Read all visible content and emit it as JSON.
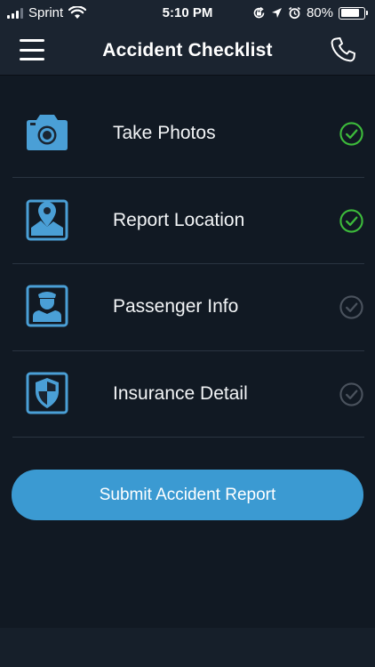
{
  "status_bar": {
    "carrier": "Sprint",
    "time": "5:10 PM",
    "battery_percent": "80%",
    "battery_level": 0.8,
    "icons": [
      "signal-icon",
      "wifi-icon",
      "screen-lock-icon",
      "location-icon",
      "alarm-icon",
      "battery-icon"
    ]
  },
  "header": {
    "title": "Accident Checklist",
    "menu_icon": "hamburger-menu-icon",
    "call_icon": "phone-icon"
  },
  "checklist": {
    "items": [
      {
        "label": "Take Photos",
        "icon": "camera-icon",
        "completed": true
      },
      {
        "label": "Report Location",
        "icon": "map-pin-icon",
        "completed": true
      },
      {
        "label": "Passenger Info",
        "icon": "passenger-icon",
        "completed": false
      },
      {
        "label": "Insurance Detail",
        "icon": "shield-icon",
        "completed": false
      }
    ]
  },
  "submit": {
    "label": "Submit Accident Report"
  },
  "colors": {
    "background": "#111923",
    "bar": "#1b2430",
    "icon_blue": "#4a9fd6",
    "check_complete": "#3dbb3b",
    "check_pending": "#4a525d",
    "button": "#3b9ad2"
  }
}
